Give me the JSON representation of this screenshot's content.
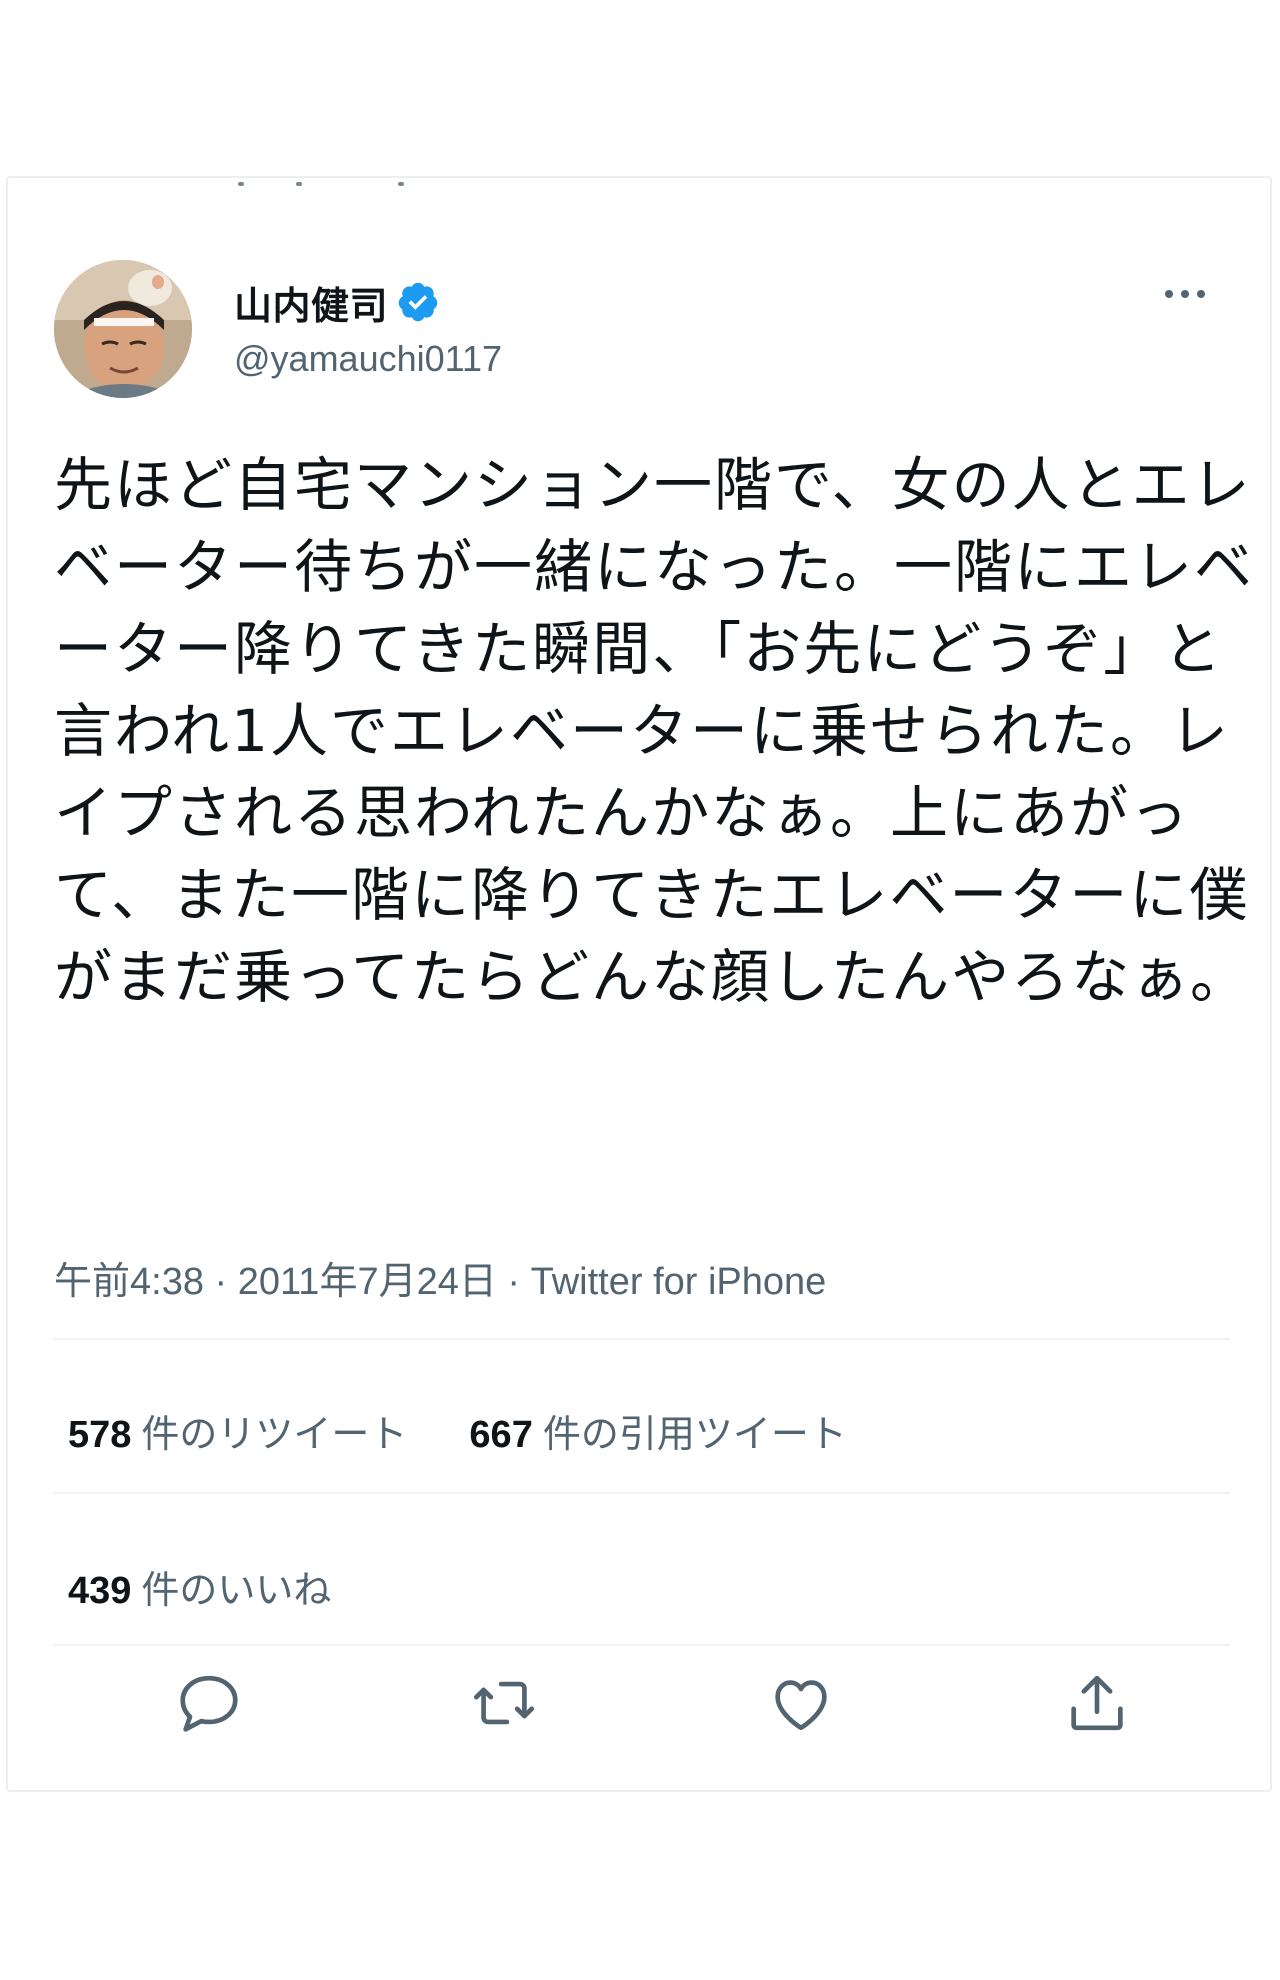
{
  "tweet": {
    "author": {
      "display_name": "山内健司",
      "handle": "@yamauchi0117",
      "verified": true
    },
    "text": "先ほど自宅マンション一階で、女の人とエレベーター待ちが一緒になった。一階にエレベーター降りてきた瞬間、「お先にどうぞ」と言われ1人でエレベーターに乗せられた。レイプされる思われたんかなぁ。上にあがって、また一階に降りてきたエレベーターに僕がまだ乗ってたらどんな顔したんやろなぁ。",
    "meta": "午前4:38 · 2011年7月24日 · Twitter for iPhone",
    "stats": {
      "retweets_count": "578",
      "retweets_label": "件のリツイート",
      "quotes_count": "667",
      "quotes_label": "件の引用ツイート",
      "likes_count": "439",
      "likes_label": "件のいいね"
    }
  },
  "icons": {
    "verified": "verified-badge-icon",
    "more": "more-icon",
    "reply": "reply-icon",
    "retweet": "retweet-icon",
    "like": "like-icon",
    "share": "share-icon"
  },
  "colors": {
    "text_primary": "#0f1419",
    "text_secondary": "#536471",
    "verified_blue": "#1d9bf0",
    "divider": "#eff3f4"
  }
}
